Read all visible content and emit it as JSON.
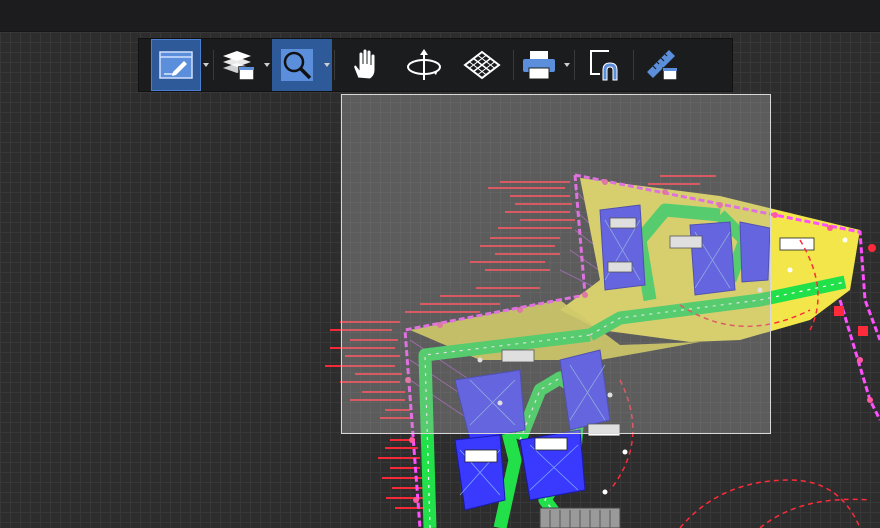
{
  "window": {
    "title": ""
  },
  "toolbar": {
    "tools": [
      {
        "id": "markup",
        "icon": "markup-pen-icon",
        "active": true,
        "has_menu": true
      },
      {
        "id": "layers",
        "icon": "layers-icon",
        "active": false,
        "has_menu": true
      },
      {
        "id": "zoom",
        "icon": "zoom-magnifier-icon",
        "active": true,
        "has_menu": true
      },
      {
        "id": "pan",
        "icon": "pan-hand-icon",
        "active": false,
        "has_menu": false
      },
      {
        "id": "orbit",
        "icon": "orbit-icon",
        "active": false,
        "has_menu": false
      },
      {
        "id": "view",
        "icon": "grid-view-icon",
        "active": false,
        "has_menu": false
      },
      {
        "id": "print",
        "icon": "print-icon",
        "active": false,
        "has_menu": true
      },
      {
        "id": "snap",
        "icon": "snap-magnet-icon",
        "active": false,
        "has_menu": false
      },
      {
        "id": "measure",
        "icon": "measure-ruler-icon",
        "active": false,
        "has_menu": false
      }
    ]
  },
  "colors": {
    "accent": "#2e5a9a",
    "canvas_bg": "#2d2d2d",
    "toolbar_bg": "#1b1c1e",
    "drawing_green": "#22e04a",
    "drawing_magenta": "#ff40ff",
    "drawing_yellow": "#f5e64a",
    "drawing_red": "#ff2a3a",
    "drawing_blue": "#3a3aff"
  }
}
